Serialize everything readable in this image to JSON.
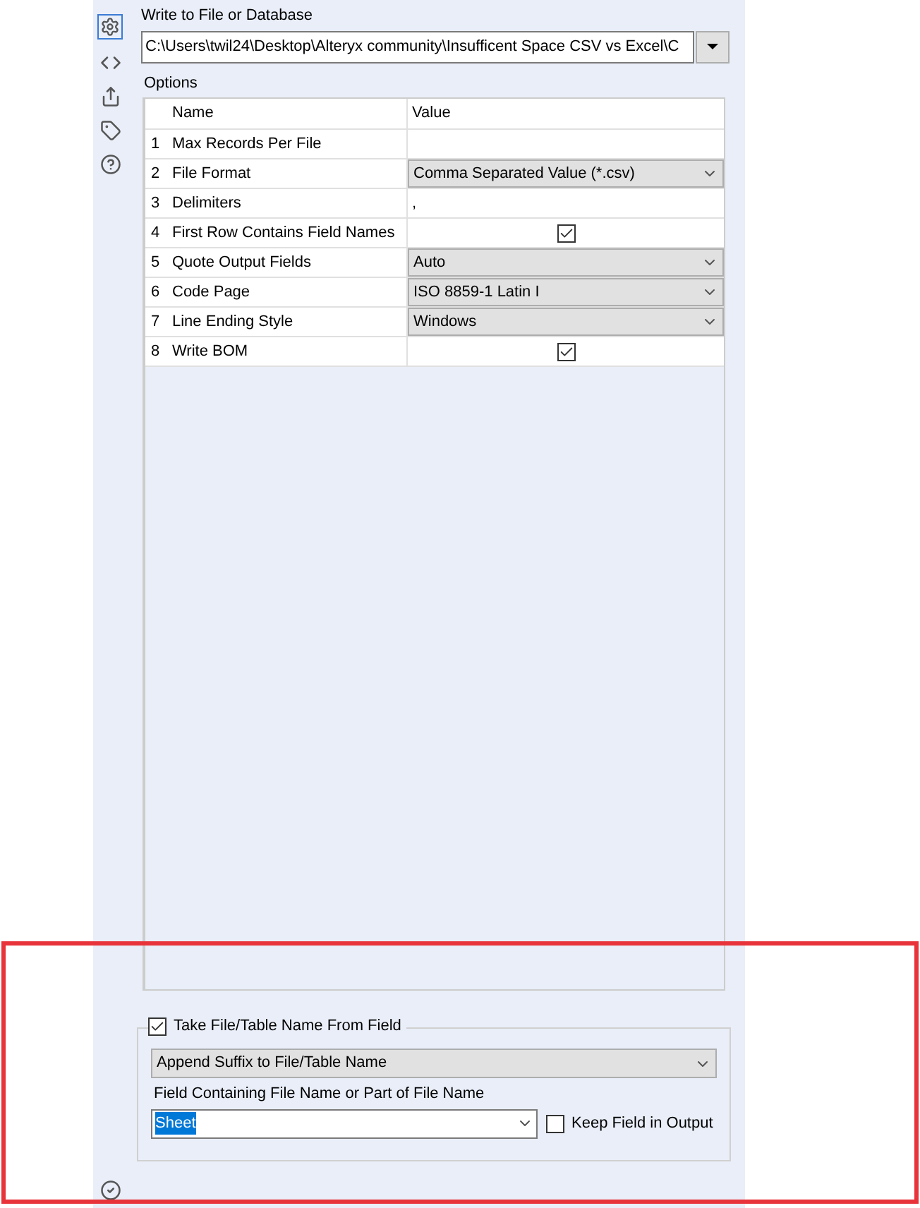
{
  "section_title": "Write to File or Database",
  "path_field": {
    "value": "C:\\Users\\twil24\\Desktop\\Alteryx community\\Insufficent Space CSV vs Excel\\C"
  },
  "options": {
    "label": "Options",
    "columns": [
      "Name",
      "Value"
    ],
    "rows": [
      {
        "number": "1",
        "name": "Max Records Per File",
        "kind": "text",
        "value": ""
      },
      {
        "number": "2",
        "name": "File Format",
        "kind": "dropdown",
        "value": "Comma Separated Value (*.csv)"
      },
      {
        "number": "3",
        "name": "Delimiters",
        "kind": "text",
        "value": ","
      },
      {
        "number": "4",
        "name": "First Row Contains Field Names",
        "kind": "checkbox",
        "checked": true
      },
      {
        "number": "5",
        "name": "Quote Output Fields",
        "kind": "dropdown",
        "value": "Auto"
      },
      {
        "number": "6",
        "name": "Code Page",
        "kind": "dropdown",
        "value": "ISO 8859-1 Latin I"
      },
      {
        "number": "7",
        "name": "Line Ending Style",
        "kind": "dropdown",
        "value": "Windows"
      },
      {
        "number": "8",
        "name": "Write BOM",
        "kind": "checkbox",
        "checked": true
      }
    ]
  },
  "take_name_from_field": {
    "label": "Take File/Table Name From Field",
    "checked": true,
    "mode": "Append Suffix to File/Table Name",
    "field_label": "Field Containing File Name or Part of File Name",
    "field_value": "Sheet",
    "keep_field": {
      "label": "Keep Field in Output",
      "checked": false
    }
  }
}
